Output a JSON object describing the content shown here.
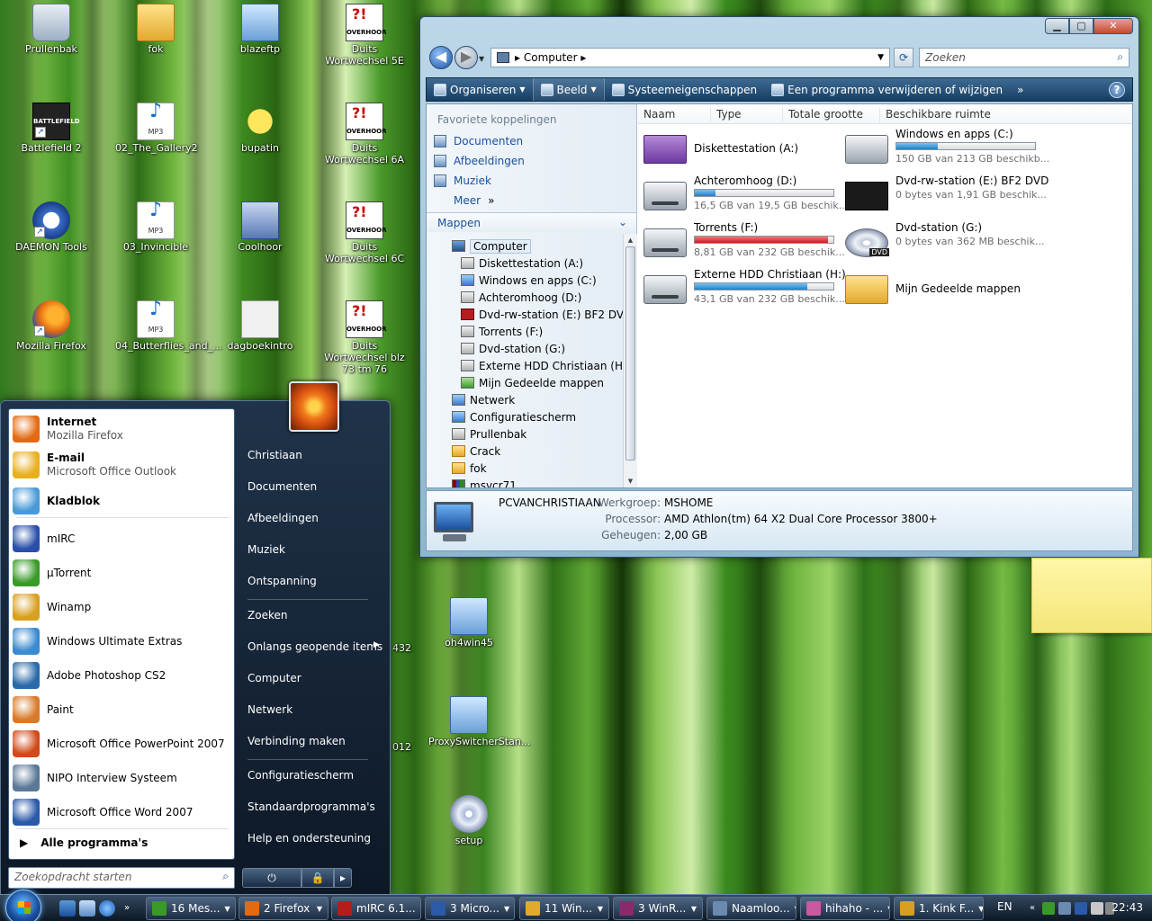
{
  "desktop_icons": [
    {
      "id": "prullenbak",
      "label": "Prullenbak",
      "icon": "recycle-bin-icon"
    },
    {
      "id": "fok",
      "label": "fok",
      "icon": "folder-icon"
    },
    {
      "id": "blazeftp",
      "label": "blazeftp",
      "icon": "network-app-icon"
    },
    {
      "id": "duits5e",
      "label": "Duits Wortwechsel 5E",
      "icon": "overhoor-icon"
    },
    {
      "id": "battlefield",
      "label": "Battlefield 2",
      "icon": "battlefield-icon"
    },
    {
      "id": "gallery",
      "label": "02_The_Gallery2",
      "icon": "mp3-icon"
    },
    {
      "id": "bupatin",
      "label": "bupatin",
      "icon": "smiley-icon"
    },
    {
      "id": "duits6a",
      "label": "Duits Wortwechsel 6A",
      "icon": "overhoor-icon"
    },
    {
      "id": "daemon",
      "label": "DAEMON Tools",
      "icon": "daemon-tools-icon"
    },
    {
      "id": "invincible",
      "label": "03_Invincible",
      "icon": "mp3-icon"
    },
    {
      "id": "coolhoor",
      "label": "Coolhoor",
      "icon": "app-window-icon"
    },
    {
      "id": "duits6c",
      "label": "Duits Wortwechsel 6C",
      "icon": "overhoor-icon"
    },
    {
      "id": "firefox",
      "label": "Mozilla Firefox",
      "icon": "firefox-icon"
    },
    {
      "id": "butterflies",
      "label": "04_Butterflies_and_...",
      "icon": "mp3-icon"
    },
    {
      "id": "dagboek",
      "label": "dagboekintro",
      "icon": "document-icon"
    },
    {
      "id": "duits73",
      "label": "Duits Wortwechsel blz 73 tm 76",
      "icon": "overhoor-icon"
    },
    {
      "id": "oh4win",
      "label": "oh4win45",
      "icon": "installer-icon"
    },
    {
      "id": "proxy",
      "label": "ProxySwitcherStan...",
      "icon": "installer-icon"
    },
    {
      "id": "setup",
      "label": "setup",
      "icon": "cd-setup-icon"
    }
  ],
  "desktop_partial_labels": {
    "p432": "432",
    "p012": "012"
  },
  "icon_texts": {
    "overhoor": "OVERHOOR",
    "mp3": "MP3",
    "battlefield": "BATTLEFIELD",
    "overhoor_mark": "?!"
  },
  "explorer": {
    "address": "Computer",
    "search_placeholder": "Zoeken",
    "commands": [
      "Organiseren",
      "Beeld",
      "Systeemeigenschappen",
      "Een programma verwijderen of wijzigen"
    ],
    "more_commands": "»",
    "help": "?",
    "favorites_header": "Favoriete koppelingen",
    "favorites": [
      "Documenten",
      "Afbeeldingen",
      "Muziek"
    ],
    "meer": "Meer",
    "meer_arrow": "»",
    "mappen": "Mappen",
    "tree": [
      {
        "label": "Computer",
        "level": 0,
        "icon": "computer-icon",
        "selected": true
      },
      {
        "label": "Diskettestation (A:)",
        "level": 1,
        "icon": "floppy-icon"
      },
      {
        "label": "Windows en apps (C:)",
        "level": 1,
        "icon": "windows-drive-icon"
      },
      {
        "label": "Achteromhoog (D:)",
        "level": 1,
        "icon": "hdd-icon"
      },
      {
        "label": "Dvd-rw-station (E:) BF2 DVD",
        "level": 1,
        "icon": "battlefield-disc-icon"
      },
      {
        "label": "Torrents (F:)",
        "level": 1,
        "icon": "hdd-icon"
      },
      {
        "label": "Dvd-station (G:)",
        "level": 1,
        "icon": "dvd-icon"
      },
      {
        "label": "Externe HDD Christiaan (H:)",
        "level": 1,
        "icon": "hdd-icon"
      },
      {
        "label": "Mijn Gedeelde mappen",
        "level": 1,
        "icon": "shared-folder-icon"
      },
      {
        "label": "Netwerk",
        "level": 0,
        "icon": "network-icon"
      },
      {
        "label": "Configuratiescherm",
        "level": 0,
        "icon": "control-panel-icon"
      },
      {
        "label": "Prullenbak",
        "level": 0,
        "icon": "recycle-bin-icon"
      },
      {
        "label": "Crack",
        "level": 0,
        "icon": "folder-icon"
      },
      {
        "label": "fok",
        "level": 0,
        "icon": "folder-icon"
      },
      {
        "label": "msvcr71",
        "level": 0,
        "icon": "archive-icon"
      }
    ],
    "columns": [
      "Naam",
      "Type",
      "Totale grootte",
      "Beschikbare ruimte"
    ],
    "drives": [
      {
        "name": "Diskettestation (A:)",
        "free": "",
        "used_fraction": null,
        "icon": "floppy-icon",
        "color": ""
      },
      {
        "name": "Windows en apps (C:)",
        "free": "150 GB van 213 GB beschikb...",
        "used_fraction": 0.3,
        "icon": "windows-drive-icon",
        "color": "#1a82c8"
      },
      {
        "name": "Achteromhoog (D:)",
        "free": "16,5 GB van 19,5 GB beschik...",
        "used_fraction": 0.15,
        "icon": "hdd-icon",
        "color": "#1a82c8"
      },
      {
        "name": "Dvd-rw-station (E:) BF2 DVD",
        "free": "0 bytes van 1,91 GB beschik...",
        "used_fraction": null,
        "icon": "battlefield-disc-icon",
        "color": ""
      },
      {
        "name": "Torrents (F:)",
        "free": "8,81 GB van 232 GB beschik...",
        "used_fraction": 0.96,
        "icon": "hdd-icon",
        "color": "#cc1a1a"
      },
      {
        "name": "Dvd-station (G:)",
        "free": "0 bytes van 362 MB beschik...",
        "used_fraction": null,
        "icon": "dvd-icon",
        "color": ""
      },
      {
        "name": "Externe HDD Christiaan (H:)",
        "free": "43,1 GB van 232 GB beschik...",
        "used_fraction": 0.81,
        "icon": "hdd-icon",
        "color": "#1a82c8"
      },
      {
        "name": "Mijn Gedeelde mappen",
        "free": "",
        "used_fraction": null,
        "icon": "shared-folder-icon",
        "color": ""
      }
    ],
    "dvd_label": "DVD",
    "details": {
      "computer_name": "PCVANCHRISTIAAN",
      "workgroup_label": "Werkgroep:",
      "workgroup": "MSHOME",
      "processor_label": "Processor:",
      "processor": "AMD Athlon(tm) 64 X2 Dual Core Processor 3800+",
      "memory_label": "Geheugen:",
      "memory": "2,00 GB"
    }
  },
  "start_menu": {
    "pinned": [
      {
        "title": "Internet",
        "subtitle": "Mozilla Firefox",
        "icon": "firefox-icon",
        "color": "#e36a12"
      },
      {
        "title": "E-mail",
        "subtitle": "Microsoft Office Outlook",
        "icon": "outlook-icon",
        "color": "#e8b020"
      },
      {
        "title": "Kladblok",
        "subtitle": "",
        "icon": "notepad-icon",
        "color": "#4a9ad8"
      }
    ],
    "recent": [
      {
        "label": "mIRC",
        "icon": "mirc-icon",
        "color": "#2a4faa"
      },
      {
        "label": "µTorrent",
        "icon": "utorrent-icon",
        "color": "#3a9a28"
      },
      {
        "label": "Winamp",
        "icon": "winamp-icon",
        "color": "#d8a020"
      },
      {
        "label": "Windows Ultimate Extras",
        "icon": "extras-icon",
        "color": "#3a8ad0"
      },
      {
        "label": "Adobe Photoshop CS2",
        "icon": "photoshop-icon",
        "color": "#2a6aa8"
      },
      {
        "label": "Paint",
        "icon": "paint-icon",
        "color": "#d87a2a"
      },
      {
        "label": "Microsoft Office PowerPoint 2007",
        "icon": "powerpoint-icon",
        "color": "#d04a1a"
      },
      {
        "label": "NIPO Interview Systeem",
        "icon": "nipo-icon",
        "color": "#5a7898"
      },
      {
        "label": "Microsoft Office Word 2007",
        "icon": "word-icon",
        "color": "#2a5aa8"
      }
    ],
    "all_programs": "Alle programma's",
    "search_placeholder": "Zoekopdracht starten",
    "right": [
      "Christiaan",
      "Documenten",
      "Afbeeldingen",
      "Muziek",
      "Ontspanning",
      "Zoeken",
      "Onlangs geopende items",
      "Computer",
      "Netwerk",
      "Verbinding maken",
      "Configuratiescherm",
      "Standaardprogramma's",
      "Help en ondersteuning"
    ]
  },
  "taskbar": {
    "buttons": [
      {
        "label": "16 Mes...",
        "icon": "messenger-icon",
        "color": "#3a9a28"
      },
      {
        "label": "2 Firefox",
        "icon": "firefox-icon",
        "color": "#e36a12"
      },
      {
        "label": "mIRC 6.1...",
        "icon": "mirc-icon",
        "color": "#b51c1c"
      },
      {
        "label": "3 Micro...",
        "icon": "office-icon",
        "color": "#2a5aa8"
      },
      {
        "label": "11 Win...",
        "icon": "folder-icon",
        "color": "#e2a92e"
      },
      {
        "label": "3 WinR...",
        "icon": "winrar-icon",
        "color": "#8a2a6a"
      },
      {
        "label": "Naamloo...",
        "icon": "notepad-icon",
        "color": "#6a8ab0"
      },
      {
        "label": "hihaho - ...",
        "icon": "web-icon",
        "color": "#c85aa0"
      },
      {
        "label": "1. Kink F...",
        "icon": "winamp-icon",
        "color": "#d8a020"
      }
    ],
    "language": "EN",
    "clock": "22:43"
  }
}
